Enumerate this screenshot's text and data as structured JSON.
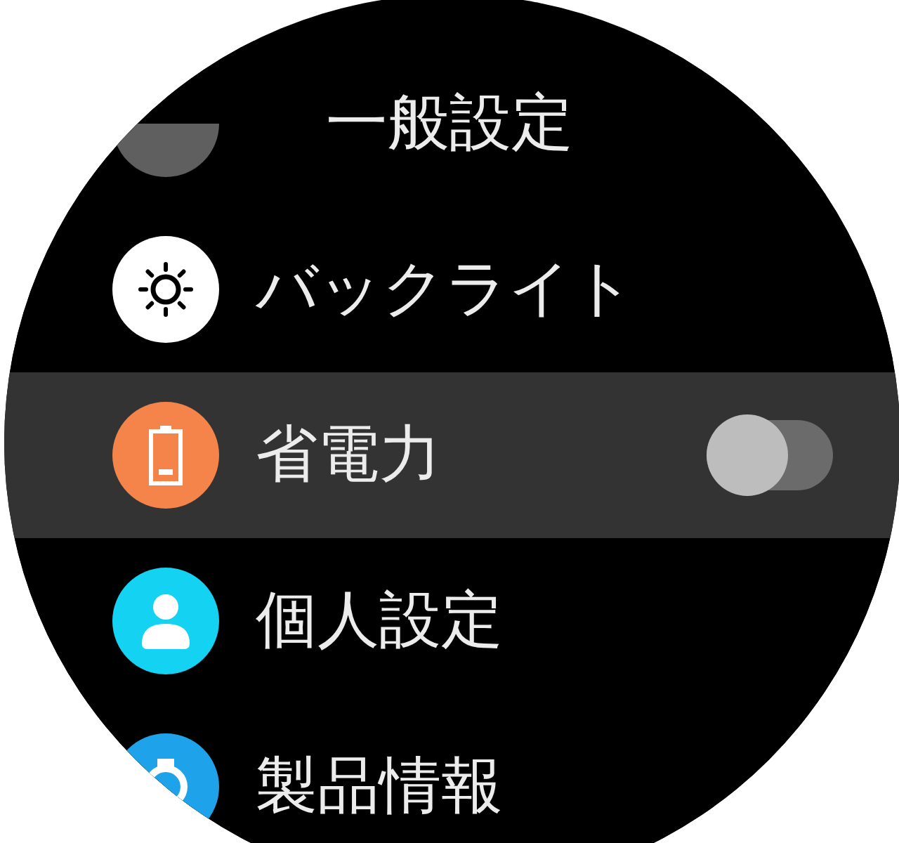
{
  "menu": {
    "items": [
      {
        "label": "一般設定",
        "kind": "plain",
        "selected": false,
        "color": "#5f5f5f"
      },
      {
        "label": "バックライト",
        "kind": "plain",
        "selected": false,
        "color": "#ffffff"
      },
      {
        "label": "省電力",
        "kind": "toggle",
        "selected": true,
        "on": false,
        "color": "#f5844a"
      },
      {
        "label": "個人設定",
        "kind": "plain",
        "selected": false,
        "color": "#14d2f2"
      },
      {
        "label": "製品情報",
        "kind": "plain",
        "selected": false,
        "color": "#1ea3ea"
      }
    ]
  }
}
